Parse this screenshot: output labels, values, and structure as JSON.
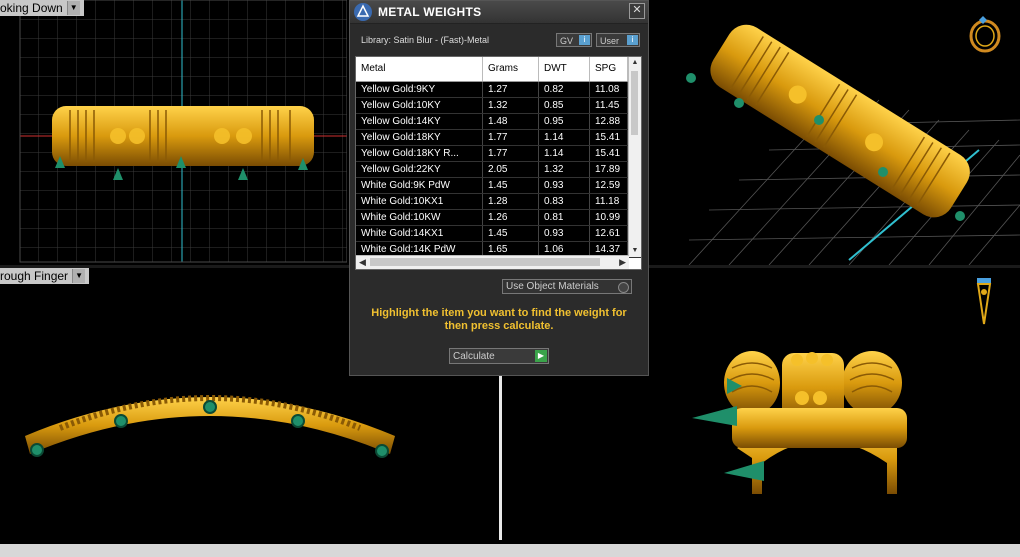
{
  "viewports": {
    "top_left": {
      "label": "oking Down"
    },
    "bottom_left": {
      "label": "rough Finger"
    }
  },
  "icons": {
    "dropdown": "chevron-down-icon",
    "ring_view": "ring-icon",
    "orient": "orientation-icon",
    "close": "close-icon"
  },
  "panel": {
    "title": "METAL WEIGHTS",
    "close_label": "✕",
    "library": "Library: Satin Blur - (Fast)-Metal",
    "tag_gv": "GV",
    "tag_user": "User",
    "columns": [
      "Metal",
      "Grams",
      "DWT",
      "SPG"
    ],
    "rows": [
      [
        "Yellow Gold:9KY",
        "1.27",
        "0.82",
        "11.08"
      ],
      [
        "Yellow Gold:10KY",
        "1.32",
        "0.85",
        "11.45"
      ],
      [
        "Yellow Gold:14KY",
        "1.48",
        "0.95",
        "12.88"
      ],
      [
        "Yellow Gold:18KY",
        "1.77",
        "1.14",
        "15.41"
      ],
      [
        "Yellow Gold:18KY R...",
        "1.77",
        "1.14",
        "15.41"
      ],
      [
        "Yellow Gold:22KY",
        "2.05",
        "1.32",
        "17.89"
      ],
      [
        "White Gold:9K PdW",
        "1.45",
        "0.93",
        "12.59"
      ],
      [
        "White Gold:10KX1",
        "1.28",
        "0.83",
        "11.18"
      ],
      [
        "White Gold:10KW",
        "1.26",
        "0.81",
        "10.99"
      ],
      [
        "White Gold:14KX1",
        "1.45",
        "0.93",
        "12.61"
      ],
      [
        "White Gold:14K PdW",
        "1.65",
        "1.06",
        "14.37"
      ]
    ],
    "use_object_materials": "Use Object Materials",
    "hint": "Highlight the item you want to find the weight for then press calculate.",
    "calculate_label": "Calculate"
  },
  "colors": {
    "gold": "#e0a818",
    "gold_dark": "#8a5a05",
    "prong_green": "#1f8f6a",
    "hint_yellow": "#f0c030",
    "axis_red": "#d03030",
    "axis_cyan": "#30c0d0"
  }
}
